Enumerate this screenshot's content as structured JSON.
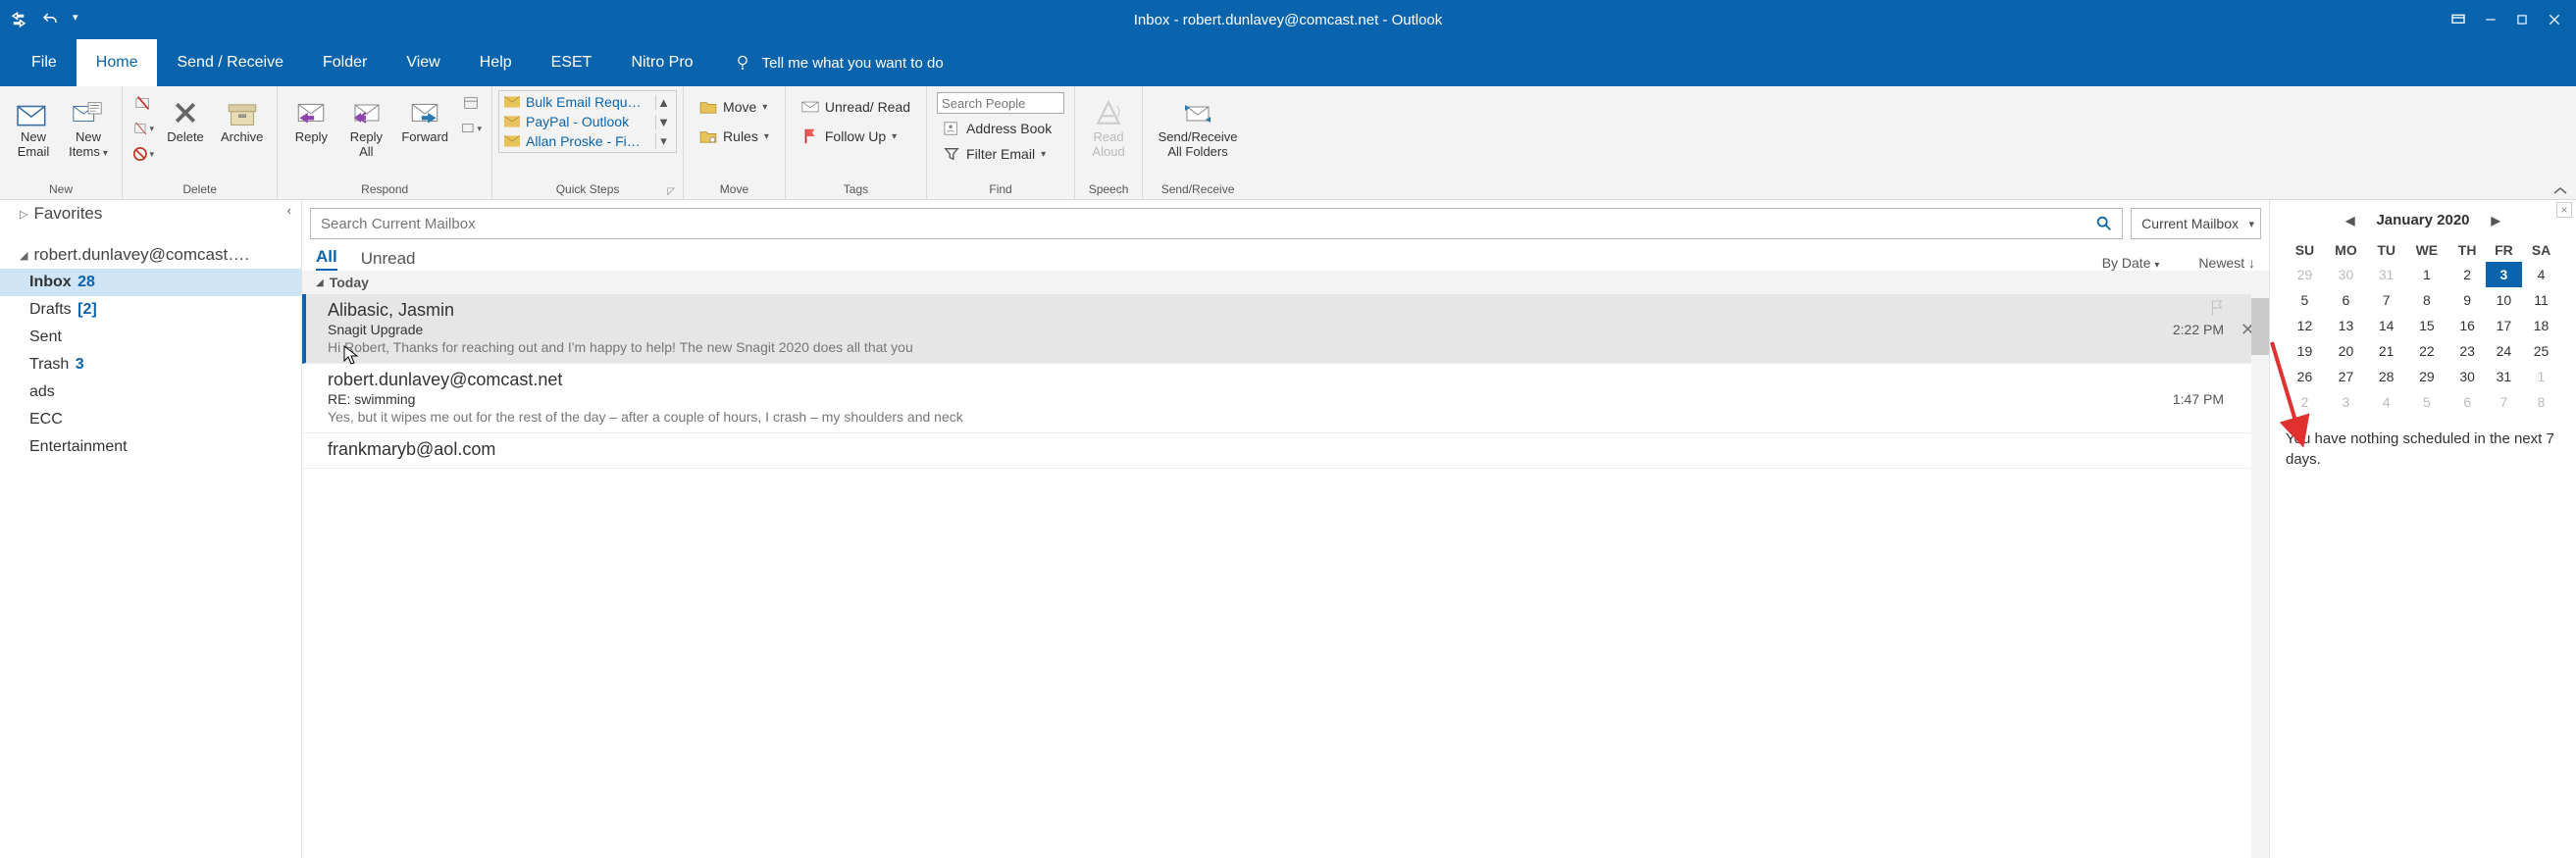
{
  "window": {
    "title": "Inbox - robert.dunlavey@comcast.net  -  Outlook"
  },
  "tabs": {
    "file": "File",
    "home": "Home",
    "send_receive": "Send / Receive",
    "folder": "Folder",
    "view": "View",
    "help": "Help",
    "eset": "ESET",
    "nitro": "Nitro Pro",
    "tell_me": "Tell me what you want to do"
  },
  "ribbon": {
    "new": {
      "label": "New",
      "new_email_l1": "New",
      "new_email_l2": "Email",
      "new_items_l1": "New",
      "new_items_l2": "Items"
    },
    "delete": {
      "label": "Delete",
      "delete_btn": "Delete",
      "archive_btn": "Archive"
    },
    "respond": {
      "label": "Respond",
      "reply": "Reply",
      "reply_all_l1": "Reply",
      "reply_all_l2": "All",
      "forward": "Forward"
    },
    "quick_steps": {
      "label": "Quick Steps",
      "items": [
        "Bulk Email Requ…",
        "PayPal - Outlook",
        "Allan Proske - Fi…"
      ]
    },
    "move": {
      "label": "Move",
      "move_btn": "Move",
      "rules_btn": "Rules"
    },
    "tags": {
      "label": "Tags",
      "unread_read": "Unread/ Read",
      "follow_up": "Follow Up"
    },
    "find": {
      "label": "Find",
      "placeholder": "Search People",
      "address_book": "Address Book",
      "filter_email": "Filter Email"
    },
    "speech": {
      "label": "Speech",
      "read_aloud_l1": "Read",
      "read_aloud_l2": "Aloud"
    },
    "sendrecv": {
      "label": "Send/Receive",
      "btn_l1": "Send/Receive",
      "btn_l2": "All Folders"
    }
  },
  "nav": {
    "favorites": "Favorites",
    "account": "robert.dunlavey@comcast….",
    "folders": [
      {
        "name": "Inbox",
        "count": "28",
        "selected": true
      },
      {
        "name": "Drafts",
        "count": "[2]"
      },
      {
        "name": "Sent"
      },
      {
        "name": "Trash",
        "count": "3"
      },
      {
        "name": "ads"
      },
      {
        "name": "ECC"
      },
      {
        "name": "Entertainment"
      }
    ]
  },
  "list": {
    "search_placeholder": "Search Current Mailbox",
    "scope": "Current Mailbox",
    "filter_all": "All",
    "filter_unread": "Unread",
    "sort_by": "By Date",
    "sort_dir": "Newest",
    "grp_today": "Today",
    "messages": [
      {
        "from": "Alibasic, Jasmin",
        "subject": "Snagit Upgrade",
        "preview": "Hi Robert,  Thanks for reaching out and I'm happy to help! The new Snagit 2020 does all that you",
        "time": "2:22 PM",
        "selected": true
      },
      {
        "from": "robert.dunlavey@comcast.net",
        "subject": "RE: swimming",
        "preview": "Yes, but it wipes me out for the rest of the day – after a couple of hours, I crash – my shoulders and neck",
        "time": "1:47 PM"
      },
      {
        "from": "frankmaryb@aol.com",
        "subject": "",
        "preview": "",
        "time": ""
      }
    ]
  },
  "calendar": {
    "title": "January 2020",
    "dow": [
      "SU",
      "MO",
      "TU",
      "WE",
      "TH",
      "FR",
      "SA"
    ],
    "weeks": [
      [
        {
          "d": "29",
          "o": 1
        },
        {
          "d": "30",
          "o": 1
        },
        {
          "d": "31",
          "o": 1
        },
        {
          "d": "1"
        },
        {
          "d": "2"
        },
        {
          "d": "3",
          "t": 1
        },
        {
          "d": "4"
        }
      ],
      [
        {
          "d": "5"
        },
        {
          "d": "6"
        },
        {
          "d": "7"
        },
        {
          "d": "8"
        },
        {
          "d": "9"
        },
        {
          "d": "10"
        },
        {
          "d": "11"
        }
      ],
      [
        {
          "d": "12"
        },
        {
          "d": "13"
        },
        {
          "d": "14"
        },
        {
          "d": "15"
        },
        {
          "d": "16"
        },
        {
          "d": "17"
        },
        {
          "d": "18"
        }
      ],
      [
        {
          "d": "19"
        },
        {
          "d": "20"
        },
        {
          "d": "21"
        },
        {
          "d": "22"
        },
        {
          "d": "23"
        },
        {
          "d": "24"
        },
        {
          "d": "25"
        }
      ],
      [
        {
          "d": "26"
        },
        {
          "d": "27"
        },
        {
          "d": "28"
        },
        {
          "d": "29"
        },
        {
          "d": "30"
        },
        {
          "d": "31"
        },
        {
          "d": "1",
          "o": 1
        }
      ],
      [
        {
          "d": "2",
          "o": 1
        },
        {
          "d": "3",
          "o": 1
        },
        {
          "d": "4",
          "o": 1
        },
        {
          "d": "5",
          "o": 1
        },
        {
          "d": "6",
          "o": 1
        },
        {
          "d": "7",
          "o": 1
        },
        {
          "d": "8",
          "o": 1
        }
      ]
    ],
    "note": "You have nothing scheduled in the next 7 days."
  }
}
